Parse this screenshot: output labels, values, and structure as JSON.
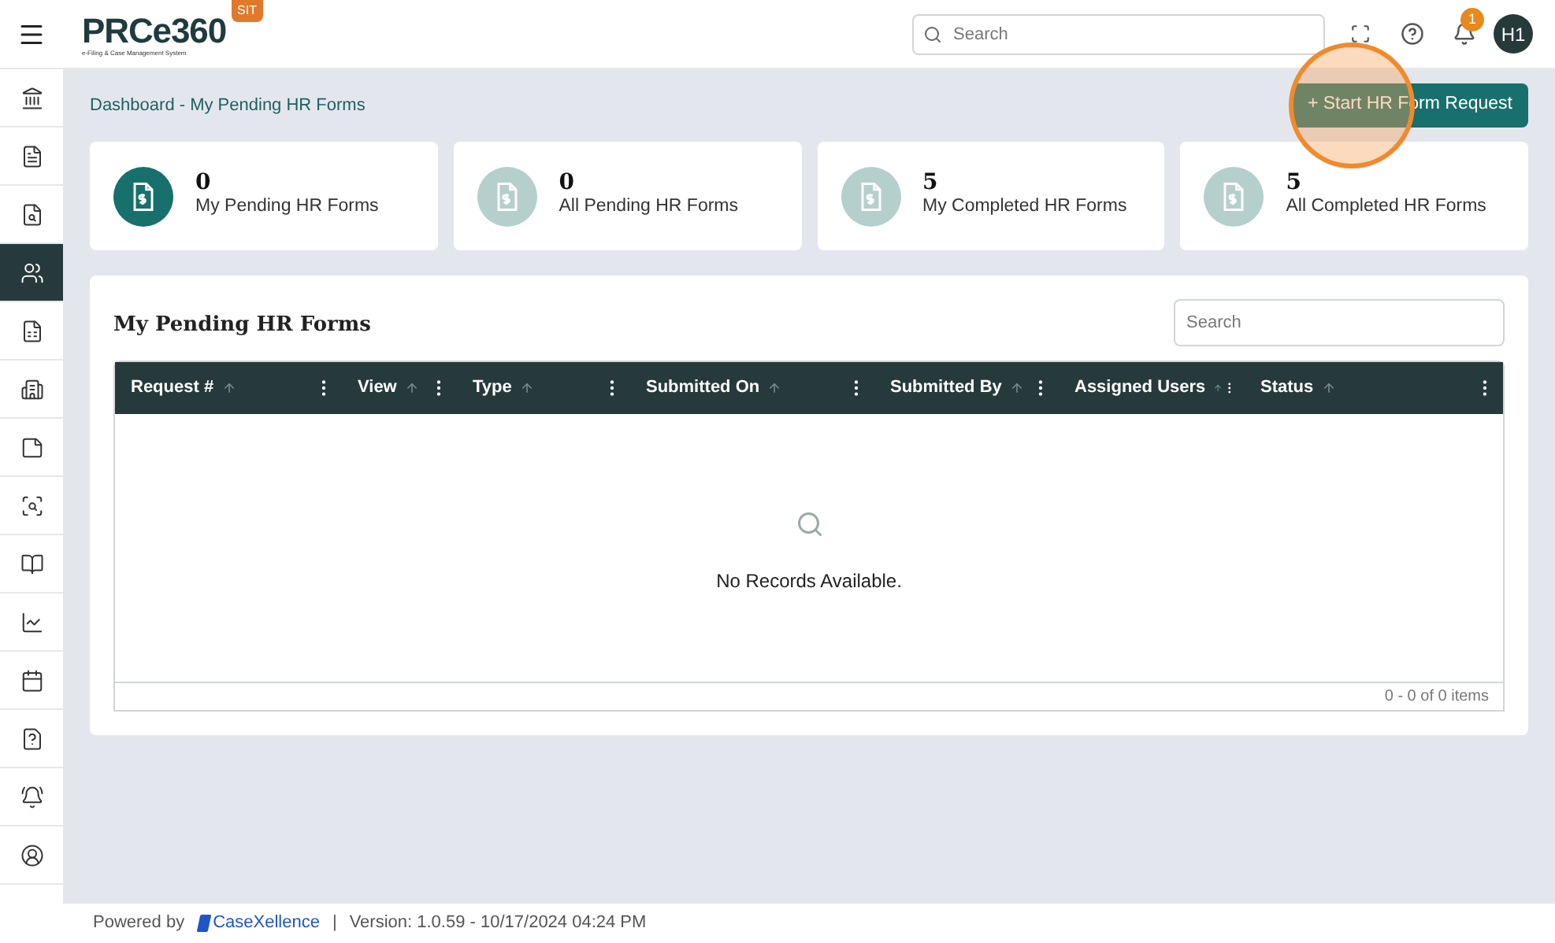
{
  "header": {
    "logo": "PRCe360",
    "logo_tagline": "e-Filing & Case Management System",
    "env_badge": "SIT",
    "search": {
      "placeholder": "Search"
    },
    "notification_count": "1",
    "avatar": "H1"
  },
  "sidebar": {
    "items": [
      {
        "selected": false
      },
      {
        "selected": false
      },
      {
        "selected": false
      },
      {
        "selected": true
      },
      {
        "selected": false
      },
      {
        "selected": false
      },
      {
        "selected": false
      },
      {
        "selected": false
      },
      {
        "selected": false
      },
      {
        "selected": false
      },
      {
        "selected": false
      },
      {
        "selected": false
      },
      {
        "selected": false
      },
      {
        "selected": false
      }
    ]
  },
  "breadcrumb": "Dashboard - My Pending HR Forms",
  "primary_button": "+ Start HR Form Request",
  "stat_cards": [
    {
      "value": "0",
      "label": "My Pending HR Forms",
      "selected": true
    },
    {
      "value": "0",
      "label": "All Pending HR Forms",
      "selected": false
    },
    {
      "value": "5",
      "label": "My Completed HR Forms",
      "selected": false
    },
    {
      "value": "5",
      "label": "All Completed HR Forms",
      "selected": false
    }
  ],
  "table": {
    "title": "My Pending HR Forms",
    "search": {
      "placeholder": "Search"
    },
    "columns": [
      "Request #",
      "View",
      "Type",
      "Submitted On",
      "Submitted By",
      "Assigned Users",
      "Status"
    ],
    "empty_message": "No Records Available.",
    "pager": "0 - 0 of 0 items"
  },
  "footer": {
    "powered_by": "Powered by",
    "brand": "CaseXellence",
    "separator": "|",
    "version": "Version: 1.0.59 - 10/17/2024 04:24 PM"
  }
}
